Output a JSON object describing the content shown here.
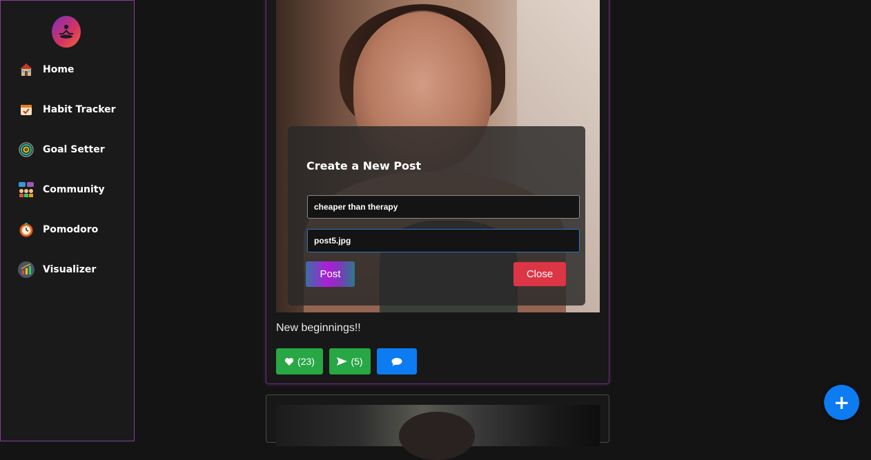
{
  "sidebar": {
    "items": [
      {
        "label": "Home",
        "icon": "house-icon"
      },
      {
        "label": "Habit Tracker",
        "icon": "calendar-check-icon"
      },
      {
        "label": "Goal Setter",
        "icon": "target-icon"
      },
      {
        "label": "Community",
        "icon": "people-chat-icon"
      },
      {
        "label": "Pomodoro",
        "icon": "timer-icon"
      },
      {
        "label": "Visualizer",
        "icon": "chart-icon"
      }
    ]
  },
  "modal": {
    "title": "Create a New Post",
    "caption_value": "cheaper than therapy",
    "image_value": "post5.jpg",
    "post_label": "Post",
    "close_label": "Close"
  },
  "post": {
    "caption": "New beginnings!!",
    "likes": "(23)",
    "shares": "(5)"
  },
  "fab": {
    "label": "+"
  },
  "colors": {
    "like": "#28a745",
    "comment": "#0d7bf2",
    "close": "#dc3545",
    "sidebar_border": "#8a3f9a"
  }
}
